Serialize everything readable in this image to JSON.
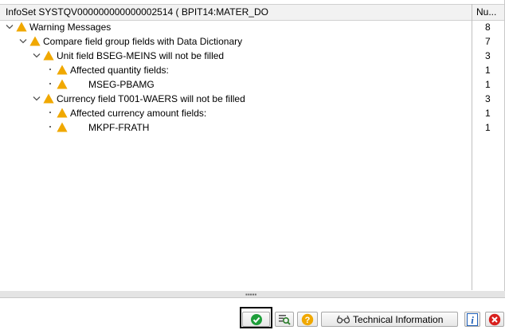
{
  "header": {
    "title": "InfoSet SYSTQV000000000000002514 ( BPIT14:MATER_DO",
    "num_col": "Nu..."
  },
  "tree": [
    {
      "label": "Warning Messages",
      "count": "8",
      "level": 0,
      "kind": "expanded"
    },
    {
      "label": "Compare field group fields with Data Dictionary",
      "count": "7",
      "level": 1,
      "kind": "expanded"
    },
    {
      "label": "Unit field BSEG-MEINS will not be filled",
      "count": "3",
      "level": 2,
      "kind": "expanded"
    },
    {
      "label": "Affected quantity fields:",
      "count": "1",
      "level": 3,
      "kind": "leaf"
    },
    {
      "label": "MSEG-PBAMG",
      "count": "1",
      "level": 3,
      "kind": "leaf-indent"
    },
    {
      "label": "Currency field T001-WAERS will not be filled",
      "count": "3",
      "level": 2,
      "kind": "expanded"
    },
    {
      "label": "Affected currency amount fields:",
      "count": "1",
      "level": 3,
      "kind": "leaf"
    },
    {
      "label": "MKPF-FRATH",
      "count": "1",
      "level": 3,
      "kind": "leaf-indent"
    }
  ],
  "toolbar": {
    "technical_information_label": "Technical Information"
  },
  "colors": {
    "warning": "#f0a800",
    "confirm": "#1e9e3a",
    "help": "#f0a800",
    "cancel": "#d8201e",
    "info": "#1f5fb8"
  }
}
